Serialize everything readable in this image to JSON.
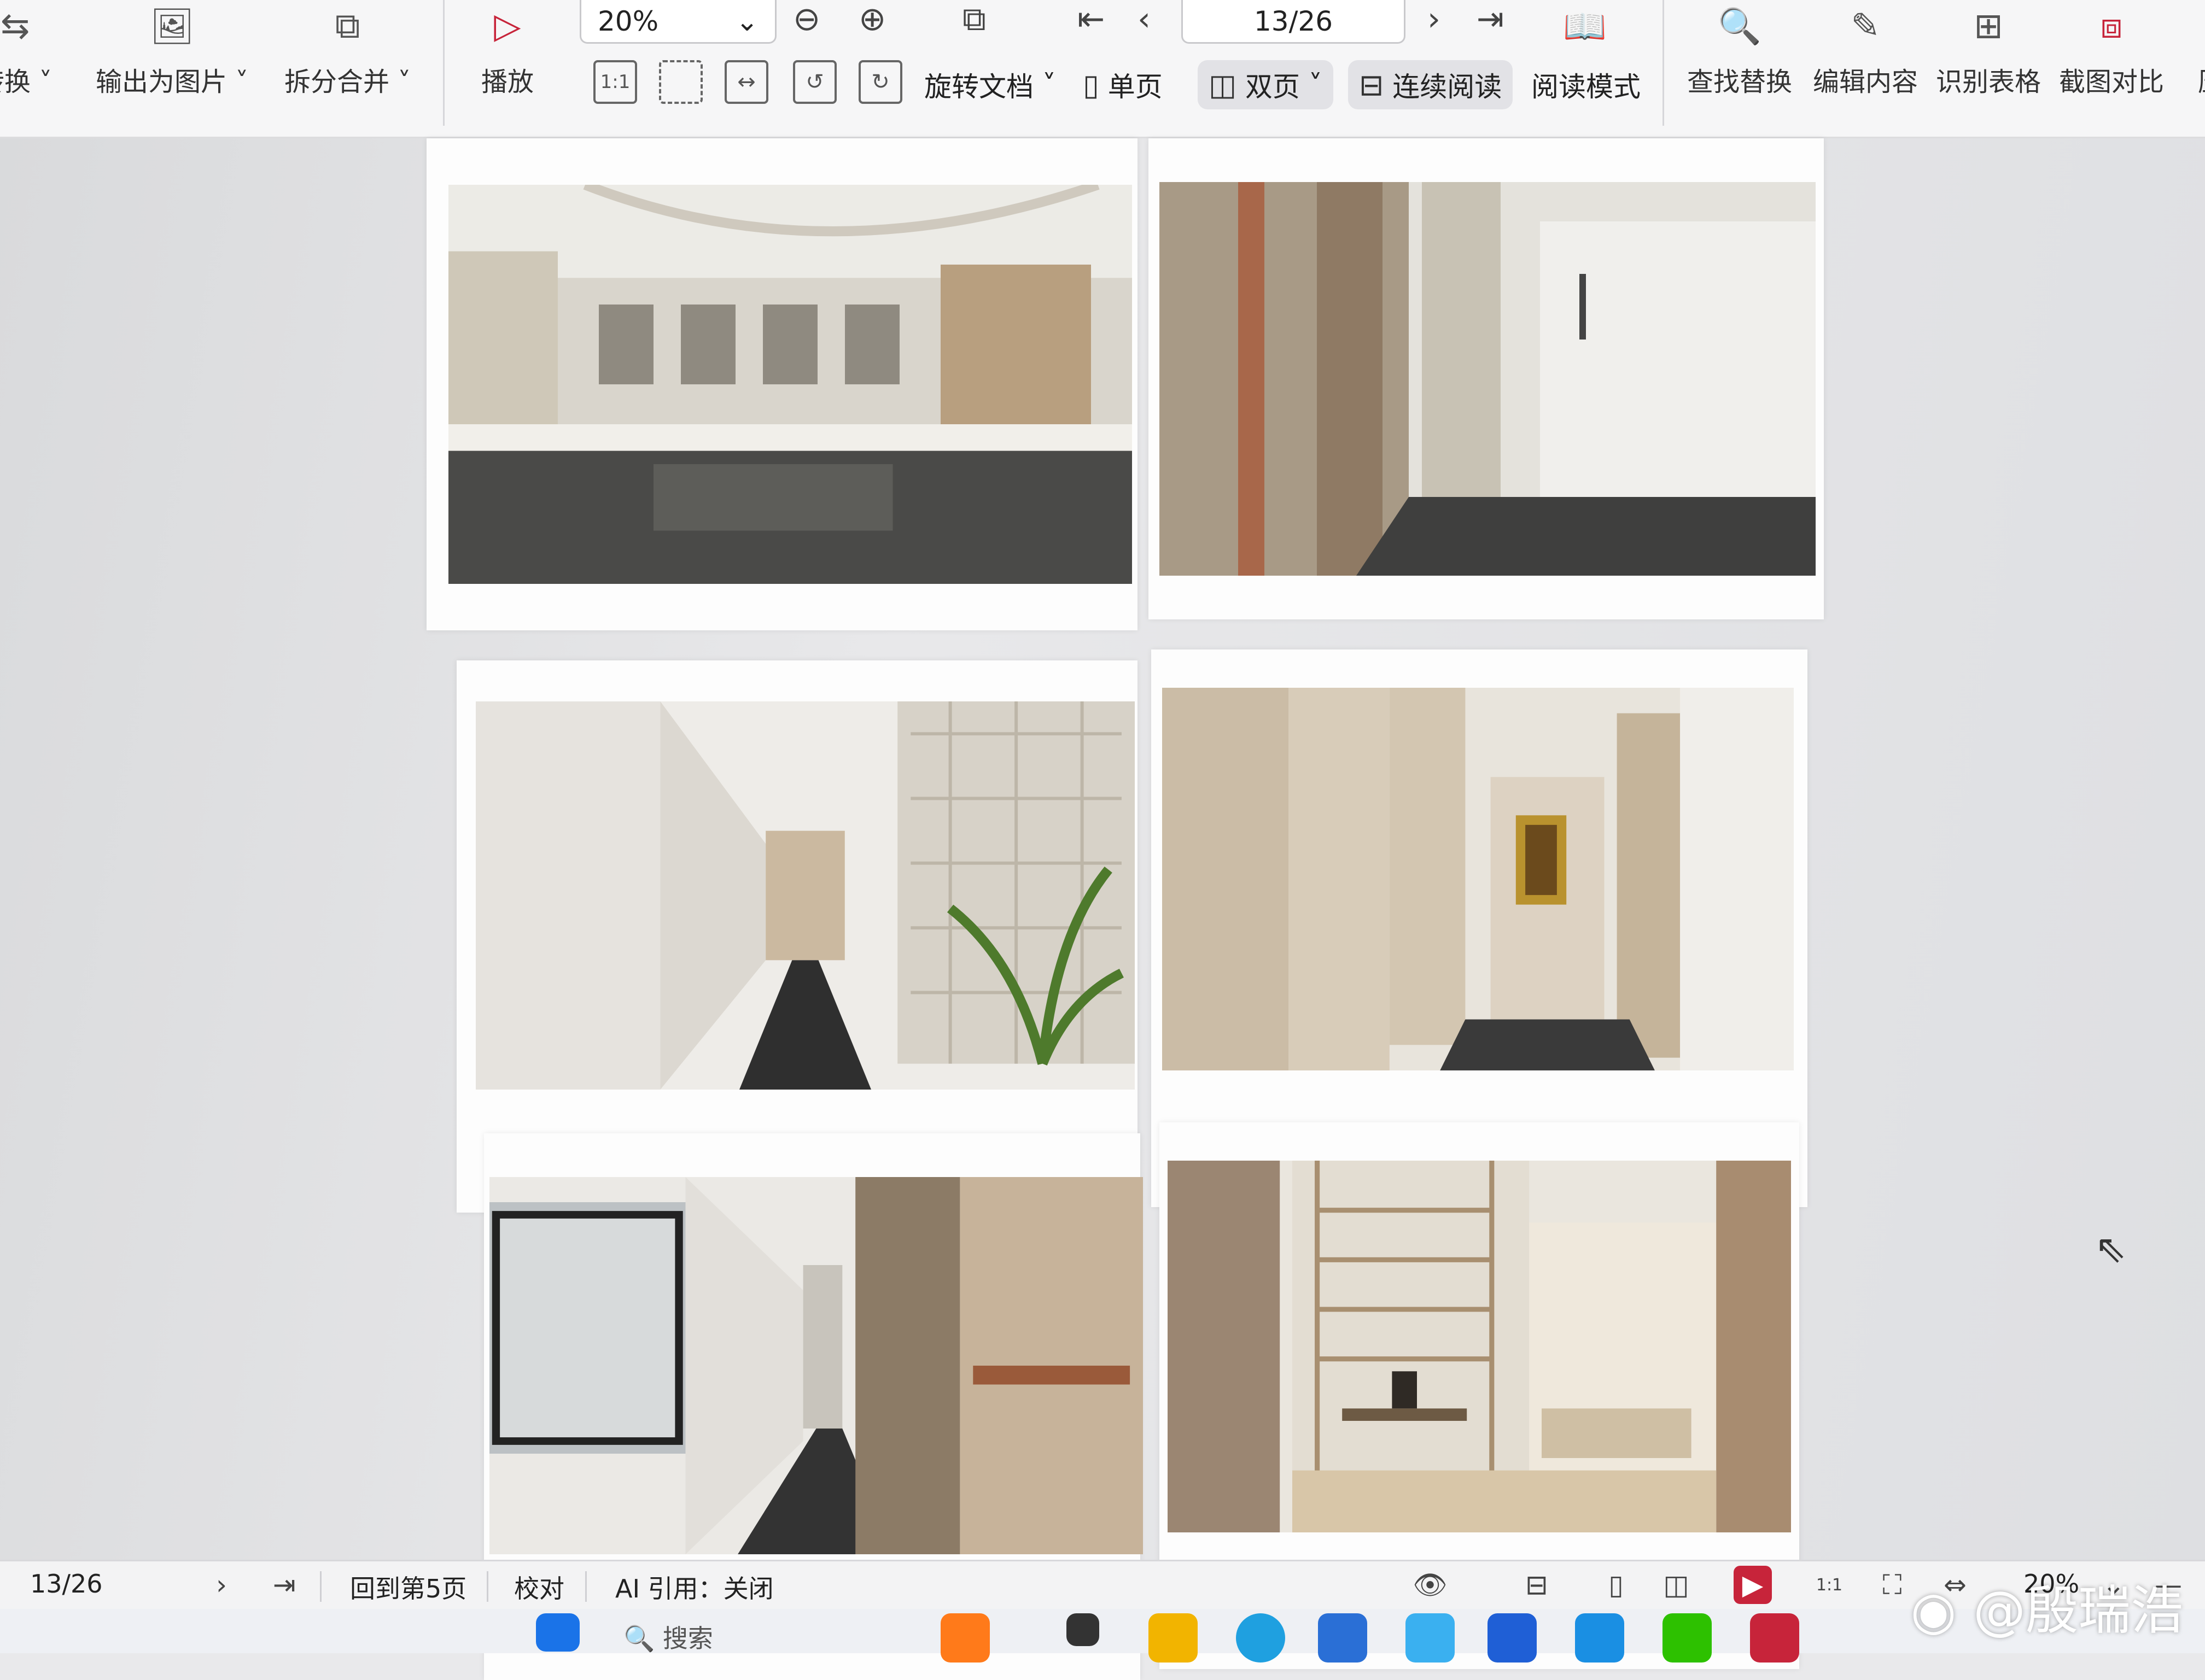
{
  "ribbon": {
    "groups": [
      {
        "id": "convert",
        "label": "转换",
        "icon": "convert-icon"
      },
      {
        "id": "export-image",
        "label": "输出为图片",
        "icon": "export-image-icon"
      },
      {
        "id": "split-merge",
        "label": "拆分合并",
        "icon": "split-merge-icon"
      },
      {
        "id": "play",
        "label": "播放",
        "icon": "play-icon"
      }
    ],
    "zoom_value": "20%",
    "page_indicator": "13/26",
    "rotate_label": "旋转文档",
    "single_page_label": "单页",
    "double_page_label": "双页",
    "continuous_label": "连续阅读",
    "read_mode_label": "阅读模式",
    "tools": [
      {
        "id": "find-replace",
        "label": "查找替换"
      },
      {
        "id": "edit-content",
        "label": "编辑内容"
      },
      {
        "id": "recognize-table",
        "label": "识别表格"
      },
      {
        "id": "screenshot-compare",
        "label": "截图对比"
      }
    ],
    "truncated_right": "压"
  },
  "document": {
    "photos": [
      {
        "id": "photo-lobby-pool",
        "scene": "lobby-pool"
      },
      {
        "id": "photo-corridor-glass",
        "scene": "corridor-glass"
      },
      {
        "id": "photo-corridor-screen",
        "scene": "corridor-screen"
      },
      {
        "id": "photo-corridor-artwork",
        "scene": "corridor-artwork"
      },
      {
        "id": "photo-window-corridor",
        "scene": "window-corridor"
      },
      {
        "id": "photo-tea-room",
        "scene": "tea-room"
      }
    ]
  },
  "statusbar": {
    "page": "13/26",
    "goto": "回到第5页",
    "proofread": "校对",
    "ai_citation": "AI 引用：关闭",
    "zoom": "20%"
  },
  "taskbar": {
    "search_placeholder": "搜索"
  },
  "watermark": "@殷瑞浩",
  "colors": {
    "accent": "#c7243a",
    "wechat": "#2dc100"
  }
}
